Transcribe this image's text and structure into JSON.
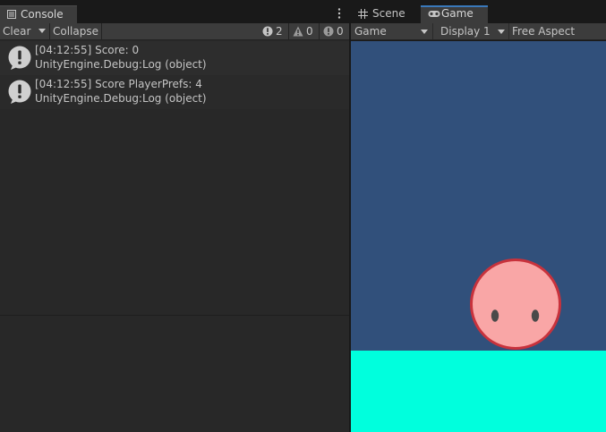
{
  "console": {
    "tab_label": "Console",
    "toolbar": {
      "clear_label": "Clear",
      "collapse_label": "Collapse",
      "log_count": "2",
      "warning_count": "0",
      "error_count": "0"
    },
    "entries": [
      {
        "line1": "[04:12:55] Score: 0",
        "line2": "UnityEngine.Debug:Log (object)"
      },
      {
        "line1": "[04:12:55] Score PlayerPrefs: 4",
        "line2": "UnityEngine.Debug:Log (object)"
      }
    ]
  },
  "game": {
    "tabs": [
      {
        "label": "Scene",
        "icon": "grid-icon"
      },
      {
        "label": "Game",
        "icon": "gamepad-icon",
        "active": true
      }
    ],
    "toolbar": {
      "display_mode": "Game",
      "display": "Display 1",
      "aspect": "Free Aspect"
    },
    "colors": {
      "sky": "#31507b",
      "ground": "#00ffdd",
      "player_fill": "#f9a6a6",
      "player_outline": "#c8323c",
      "player_eyes": "#4a4a4a",
      "active_tab_accent": "#3a79bb"
    }
  }
}
